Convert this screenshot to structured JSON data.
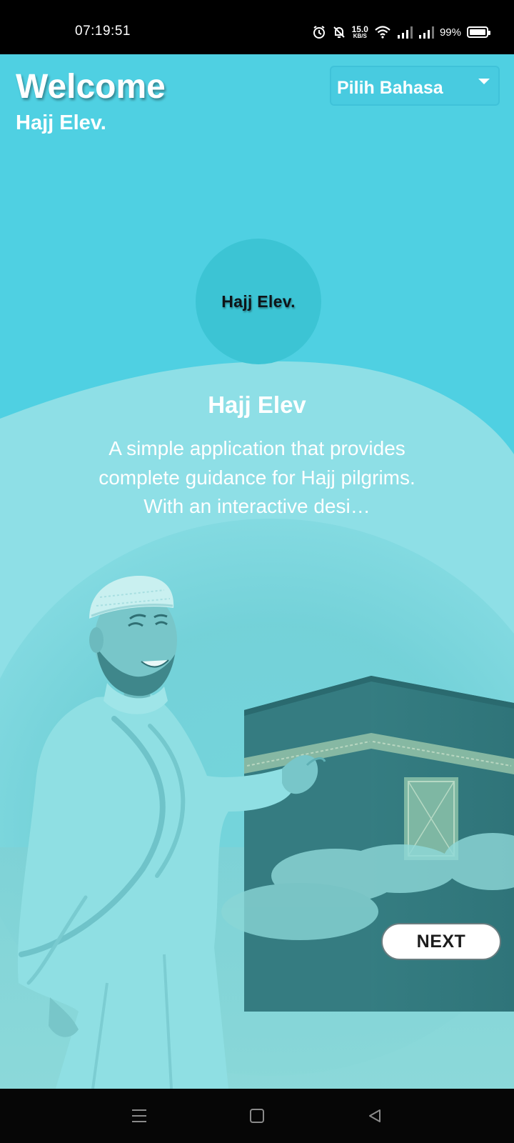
{
  "status_bar": {
    "time": "07:19:51",
    "net_speed_value": "15.0",
    "net_speed_unit": "KB/S",
    "battery_percent": "99%",
    "battery_level": 0.99,
    "icons": [
      "alarm-icon",
      "bell-off-icon",
      "wifi-icon",
      "signal-icon",
      "signal-icon",
      "battery-icon"
    ]
  },
  "header": {
    "title": "Welcome",
    "subtitle": "Hajj Elev.",
    "language_select": {
      "selected": "Pilih Bahasa",
      "icon": "dropdown-arrow-icon"
    }
  },
  "logo": {
    "text": "Hajj Elev."
  },
  "intro": {
    "title": "Hajj Elev",
    "description": "A simple application that provides complete guidance for Hajj pilgrims. With an interactive desi…"
  },
  "actions": {
    "next_label": "NEXT"
  },
  "nav_bar": {
    "icons": [
      "menu-icon",
      "home-square-icon",
      "back-triangle-icon"
    ]
  },
  "colors": {
    "background": "#4fd0e2",
    "wave": "#8edfe6",
    "logo_circle": "#3cc4d4",
    "kaaba": "#3d8c91",
    "robe": "#8fdfe3",
    "button_bg": "#ffffff",
    "button_text": "#1c1c1c"
  }
}
